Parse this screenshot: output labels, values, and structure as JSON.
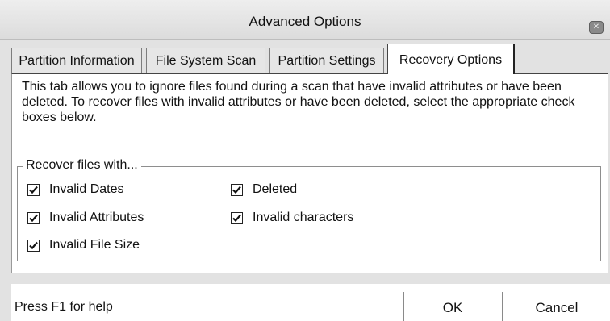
{
  "window": {
    "title": "Advanced Options",
    "close_glyph": "✕"
  },
  "tabs": [
    {
      "label": "Partition Information",
      "active": false
    },
    {
      "label": "File System Scan",
      "active": false
    },
    {
      "label": "Partition Settings",
      "active": false
    },
    {
      "label": "Recovery Options",
      "active": true
    }
  ],
  "description": "This tab allows you to ignore files found during a scan that have invalid attributes or have been deleted. To recover files with invalid attributes or have been deleted, select the appropriate check boxes below.",
  "recover_group": {
    "label": "Recover files with...",
    "options": [
      {
        "label": "Invalid Dates",
        "checked": true
      },
      {
        "label": "Invalid Attributes",
        "checked": true
      },
      {
        "label": "Invalid File Size",
        "checked": true
      },
      {
        "label": "Deleted",
        "checked": true
      },
      {
        "label": "Invalid characters",
        "checked": true
      }
    ]
  },
  "footer": {
    "help_text": "Press F1 for help",
    "ok_label": "OK",
    "cancel_label": "Cancel"
  }
}
